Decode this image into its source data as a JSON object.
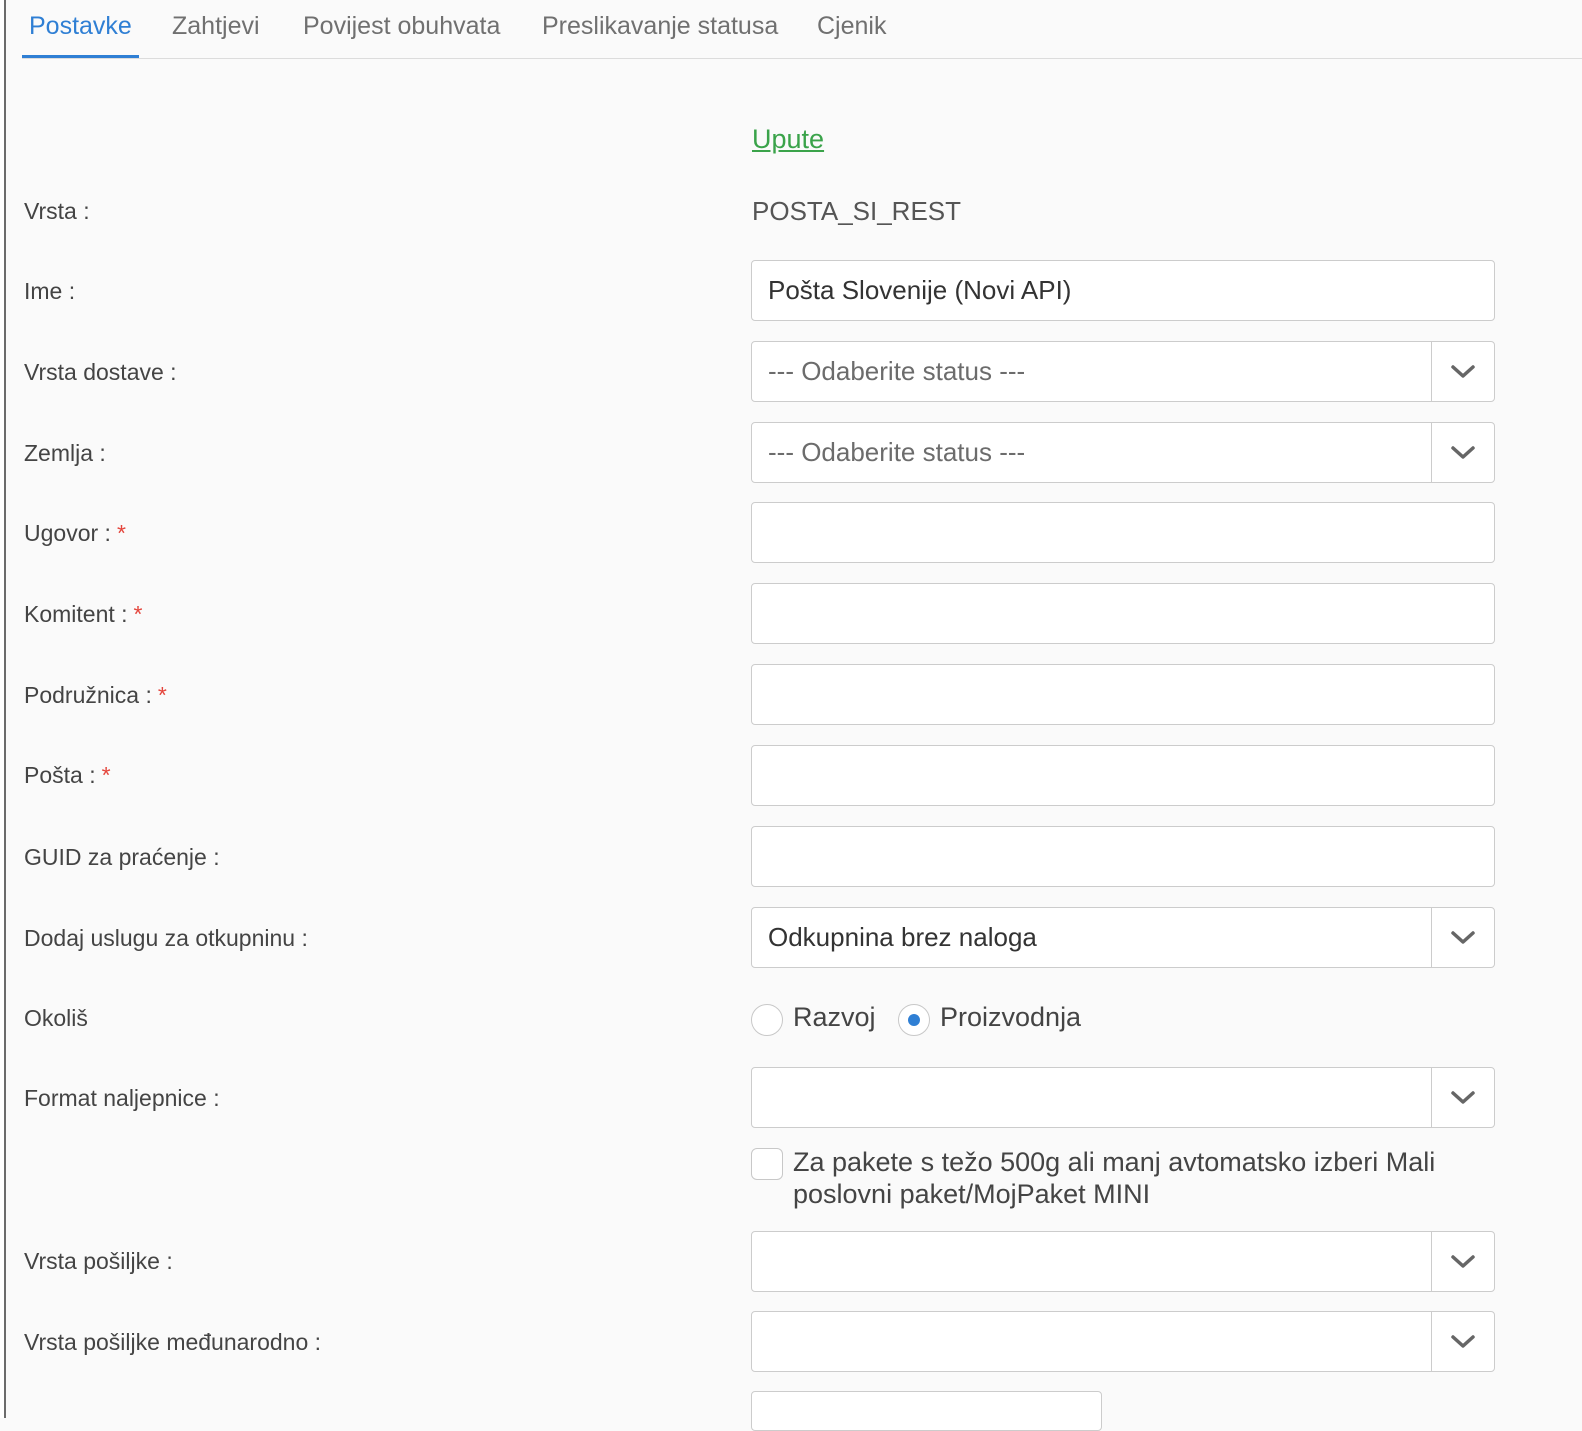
{
  "tabs": [
    {
      "label": "Postavke",
      "active": true
    },
    {
      "label": "Zahtjevi",
      "active": false
    },
    {
      "label": "Povijest obuhvata",
      "active": false
    },
    {
      "label": "Preslikavanje statusa",
      "active": false
    },
    {
      "label": "Cjenik",
      "active": false
    }
  ],
  "upute_link": "Upute",
  "form": {
    "vrsta": {
      "label": "Vrsta :",
      "value": "POSTA_SI_REST"
    },
    "ime": {
      "label": "Ime :",
      "value": "Pošta Slovenije (Novi API)"
    },
    "vrsta_dostave": {
      "label": "Vrsta dostave :",
      "placeholder": "--- Odaberite status ---"
    },
    "zemlja": {
      "label": "Zemlja :",
      "placeholder": "--- Odaberite status ---"
    },
    "ugovor": {
      "label": "Ugovor :",
      "value": ""
    },
    "komitent": {
      "label": "Komitent :",
      "value": ""
    },
    "podruznica": {
      "label": "Podružnica :",
      "value": ""
    },
    "posta": {
      "label": "Pošta :",
      "value": ""
    },
    "guid": {
      "label": "GUID za praćenje :",
      "value": ""
    },
    "otkupnina": {
      "label": "Dodaj uslugu za otkupninu :",
      "value": "Odkupnina brez naloga"
    },
    "okolis": {
      "label": "Okoliš",
      "options": [
        "Razvoj",
        "Proizvodnja"
      ],
      "selected": "Proizvodnja"
    },
    "format_naljepnice": {
      "label": "Format naljepnice :",
      "value": ""
    },
    "mali_paket": {
      "label": "Za pakete s težo 500g ali manj avtomatsko izberi Mali poslovni paket/MojPaket MINI",
      "checked": false
    },
    "vrsta_posiljke": {
      "label": "Vrsta pošiljke :",
      "value": ""
    },
    "vrsta_posiljke_medunarodno": {
      "label": "Vrsta pošiljke međunarodno :",
      "value": ""
    }
  },
  "required_marker": "*",
  "colors": {
    "accent": "#2f7fd4",
    "link": "#3aa34a",
    "required": "#e4453c"
  }
}
